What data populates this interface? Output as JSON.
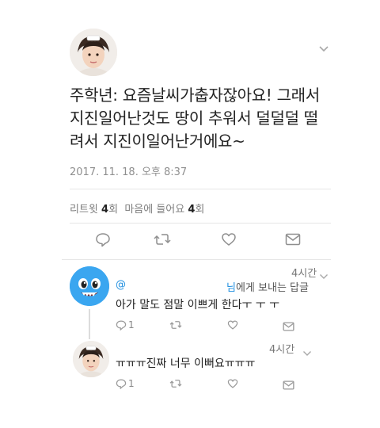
{
  "tweet": {
    "text_line1": "주학년: 요즘날씨가춥자잖아요! 그래서",
    "text_line2": "지진일어난것도 땅이 추워서 덜덜덜 떨",
    "text_line3": "려서 지진이일어난거에요~",
    "timestamp": "2017. 11. 18. 오후 8:37",
    "stats": {
      "retweet_label": "리트윗",
      "retweet_count": "4",
      "retweet_unit": "회",
      "like_label": "마음에 들어요",
      "like_count": "4",
      "like_unit": "회"
    },
    "actions": [
      "reply-icon",
      "retweet-icon",
      "like-icon",
      "message-icon"
    ]
  },
  "replies": [
    {
      "time": "4시간",
      "handle": "@",
      "reply_to_prefix": "님",
      "reply_to_suffix": "에게 보내는 답글",
      "text": "아가 말도 점말 이쁘게 한다ㅜ ㅜ ㅜ",
      "reply_count": "1"
    },
    {
      "time": "4시간",
      "text": "ㅠㅠㅠ진짜 너무 이뻐요ㅠㅠㅠ",
      "reply_count": "1"
    }
  ],
  "colors": {
    "accent_blue": "#1f8fe0",
    "mascot_blue": "#3aa6f0"
  }
}
